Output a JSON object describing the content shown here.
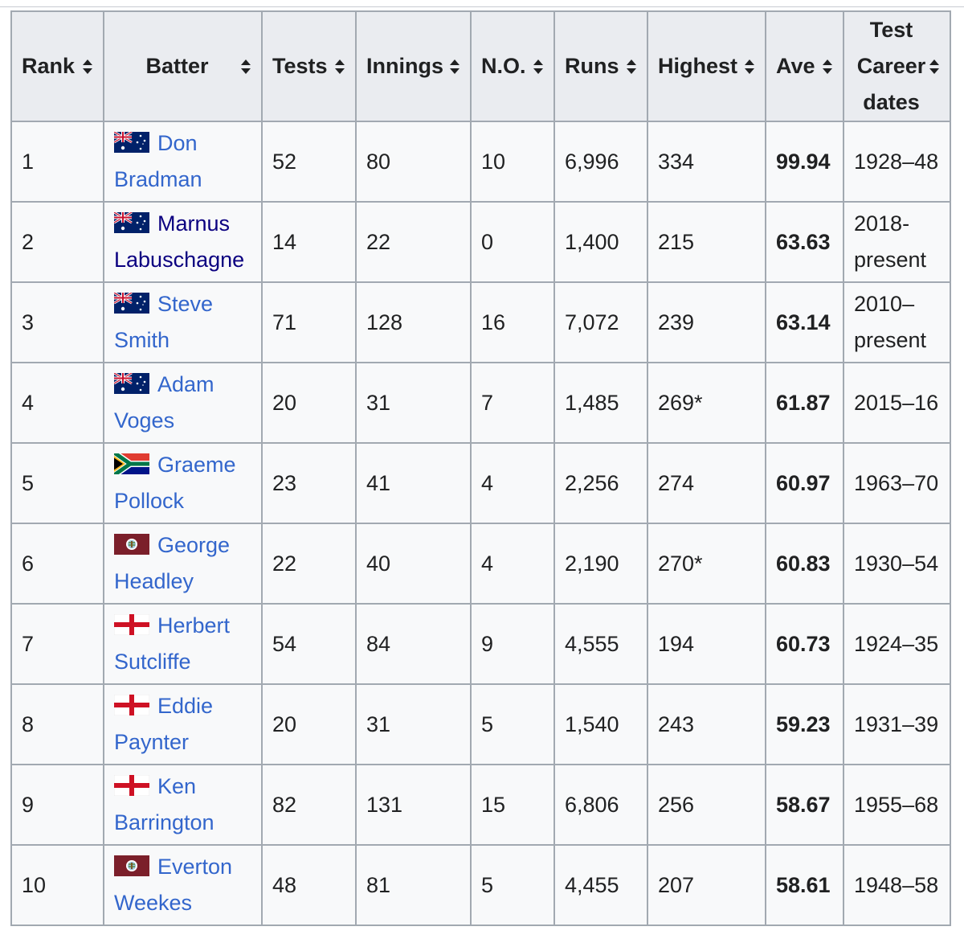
{
  "headers": {
    "rank": "Rank",
    "batter": "Batter",
    "tests": "Tests",
    "innings": "Innings",
    "no": "N.O.",
    "runs": "Runs",
    "highest": "Highest",
    "ave": "Ave",
    "dates_1": "Test",
    "dates_2": "Career",
    "dates_3": "dates"
  },
  "icons": {
    "sort": "sort-icon",
    "flags": {
      "AUS": "australia-flag-icon",
      "RSA": "south-africa-flag-icon",
      "WI": "west-indies-flag-icon",
      "ENG": "england-flag-icon"
    }
  },
  "colors": {
    "link": "#3366cc",
    "visited_link": "#0b0080",
    "header_bg": "#eaecf0",
    "cell_bg": "#f8f9fa",
    "border": "#a2a9b1"
  },
  "rows": [
    {
      "rank": "1",
      "country": "AUS",
      "first": "Don",
      "last": "Bradman",
      "tests": "52",
      "innings": "80",
      "no": "10",
      "runs": "6,996",
      "highest": "334",
      "ave": "99.94",
      "dates_1": "1928–48",
      "dates_2": ""
    },
    {
      "rank": "2",
      "country": "AUS",
      "first": "Marnus",
      "last": "Labuschagne",
      "tests": "14",
      "innings": "22",
      "no": "0",
      "runs": "1,400",
      "highest": "215",
      "ave": "63.63",
      "dates_1": "2018-",
      "dates_2": "present",
      "visited": true
    },
    {
      "rank": "3",
      "country": "AUS",
      "first": "Steve",
      "last": "Smith",
      "tests": "71",
      "innings": "128",
      "no": "16",
      "runs": "7,072",
      "highest": "239",
      "ave": "63.14",
      "dates_1": "2010–",
      "dates_2": "present"
    },
    {
      "rank": "4",
      "country": "AUS",
      "first": "Adam",
      "last": "Voges",
      "tests": "20",
      "innings": "31",
      "no": "7",
      "runs": "1,485",
      "highest": "269*",
      "ave": "61.87",
      "dates_1": "2015–16",
      "dates_2": ""
    },
    {
      "rank": "5",
      "country": "RSA",
      "first": "Graeme",
      "last": "Pollock",
      "tests": "23",
      "innings": "41",
      "no": "4",
      "runs": "2,256",
      "highest": "274",
      "ave": "60.97",
      "dates_1": "1963–70",
      "dates_2": ""
    },
    {
      "rank": "6",
      "country": "WI",
      "first": "George",
      "last": "Headley",
      "tests": "22",
      "innings": "40",
      "no": "4",
      "runs": "2,190",
      "highest": "270*",
      "ave": "60.83",
      "dates_1": "1930–54",
      "dates_2": ""
    },
    {
      "rank": "7",
      "country": "ENG",
      "first": "Herbert",
      "last": "Sutcliffe",
      "tests": "54",
      "innings": "84",
      "no": "9",
      "runs": "4,555",
      "highest": "194",
      "ave": "60.73",
      "dates_1": "1924–35",
      "dates_2": ""
    },
    {
      "rank": "8",
      "country": "ENG",
      "first": "Eddie",
      "last": "Paynter",
      "tests": "20",
      "innings": "31",
      "no": "5",
      "runs": "1,540",
      "highest": "243",
      "ave": "59.23",
      "dates_1": "1931–39",
      "dates_2": ""
    },
    {
      "rank": "9",
      "country": "ENG",
      "first": "Ken",
      "last": "Barrington",
      "tests": "82",
      "innings": "131",
      "no": "15",
      "runs": "6,806",
      "highest": "256",
      "ave": "58.67",
      "dates_1": "1955–68",
      "dates_2": ""
    },
    {
      "rank": "10",
      "country": "WI",
      "first": "Everton",
      "last": "Weekes",
      "tests": "48",
      "innings": "81",
      "no": "5",
      "runs": "4,455",
      "highest": "207",
      "ave": "58.61",
      "dates_1": "1948–58",
      "dates_2": ""
    }
  ]
}
